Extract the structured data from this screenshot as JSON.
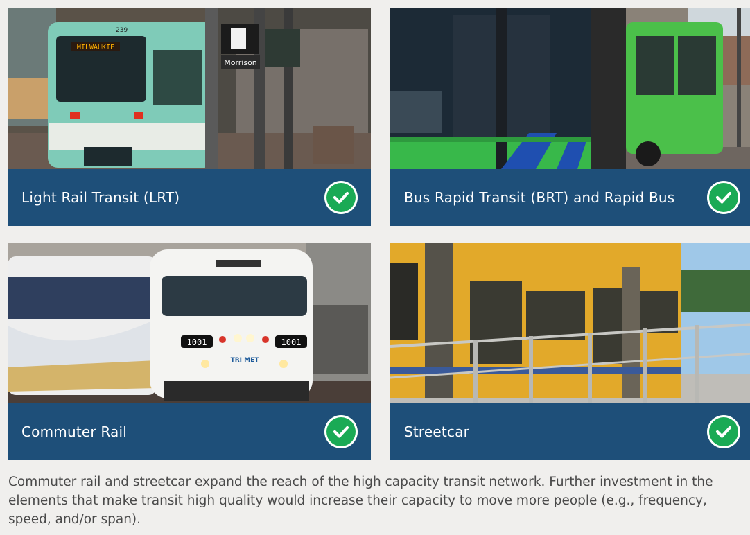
{
  "cards": [
    {
      "label": "Light Rail Transit (LRT)",
      "photo": "light-rail-train",
      "photo_text": {
        "headsign": "MILWAUKIE",
        "car_number": "239",
        "street_sign": "Morrison"
      }
    },
    {
      "label": "Bus Rapid Transit (BRT) and Rapid Bus",
      "photo": "articulated-bus",
      "photo_text": {}
    },
    {
      "label": "Commuter Rail",
      "photo": "commuter-train",
      "photo_text": {
        "unit_number": "1001",
        "logo": "TRI MET"
      }
    },
    {
      "label": "Streetcar",
      "photo": "streetcar",
      "photo_text": {}
    }
  ],
  "check_icon": "check-circle-icon",
  "colors": {
    "bar": "#1e4f79",
    "check": "#1aaa55",
    "background": "#f0efed",
    "caption": "#4a4a4a"
  },
  "caption": "Commuter rail and streetcar expand the reach of the high capacity transit network. Further investment in the elements that make transit high quality would increase their capacity to move more people (e.g., frequency, speed, and/or span)."
}
